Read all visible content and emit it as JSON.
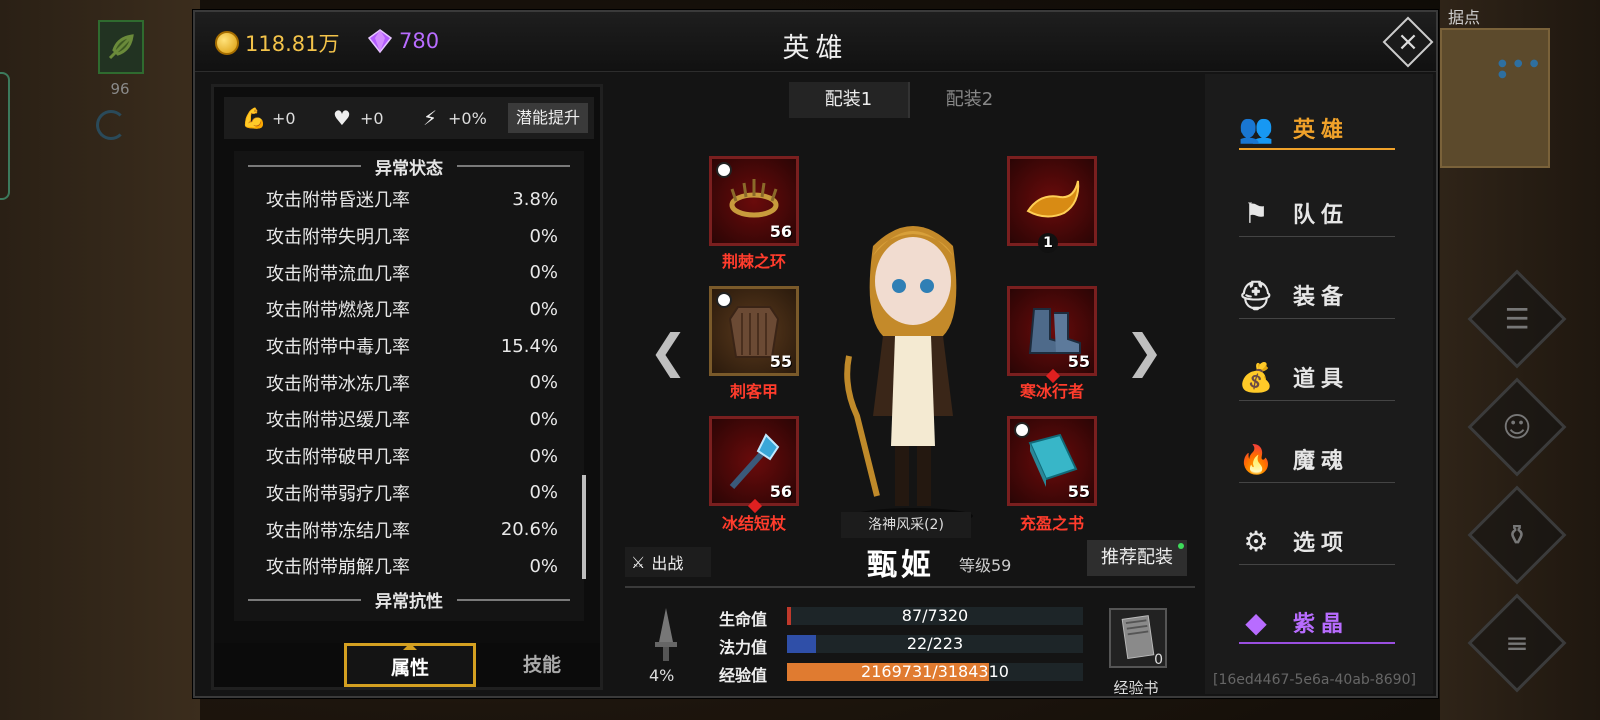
{
  "bg": {
    "mini_item_count": "96",
    "map_label": "据点"
  },
  "header": {
    "gold": "118.81万",
    "gems": "780",
    "title": "英雄"
  },
  "attr_bar": {
    "str": "+0",
    "hp": "+0",
    "spd": "+0%",
    "boost_label": "潜能提升"
  },
  "stats": {
    "section1": "异常状态",
    "rows": [
      {
        "name": "攻击附带昏迷几率",
        "value": "3.8%"
      },
      {
        "name": "攻击附带失明几率",
        "value": "0%"
      },
      {
        "name": "攻击附带流血几率",
        "value": "0%"
      },
      {
        "name": "攻击附带燃烧几率",
        "value": "0%"
      },
      {
        "name": "攻击附带中毒几率",
        "value": "15.4%"
      },
      {
        "name": "攻击附带冰冻几率",
        "value": "0%"
      },
      {
        "name": "攻击附带迟缓几率",
        "value": "0%"
      },
      {
        "name": "攻击附带破甲几率",
        "value": "0%"
      },
      {
        "name": "攻击附带弱疗几率",
        "value": "0%"
      },
      {
        "name": "攻击附带冻结几率",
        "value": "20.6%"
      },
      {
        "name": "攻击附带崩解几率",
        "value": "0%"
      }
    ],
    "section2": "异常抗性"
  },
  "left_tabs": {
    "attr": "属性",
    "skill": "技能"
  },
  "loadout": {
    "tab1": "配装1",
    "tab2": "配装2"
  },
  "equip": {
    "head": {
      "name": "荆棘之环",
      "level": "56"
    },
    "charm": {
      "count": "1"
    },
    "armor": {
      "name": "刺客甲",
      "level": "55"
    },
    "boots": {
      "name": "寒冰行者",
      "level": "55"
    },
    "weapon": {
      "name": "冰结短杖",
      "level": "56"
    },
    "book": {
      "name": "充盈之书",
      "level": "55"
    }
  },
  "hero": {
    "set": "洛神风采(2)",
    "sortie": "出战",
    "name": "甄姬",
    "level": "等级59",
    "recommend": "推荐配装"
  },
  "vitals": {
    "crit_pct": "4%",
    "hp_label": "生命值",
    "hp_text": "87/7320",
    "hp_ratio": 0.012,
    "mp_label": "法力值",
    "mp_text": "22/223",
    "mp_ratio": 0.099,
    "xp_label": "经验值",
    "xp_text": "2169731/3184310",
    "xp_ratio": 0.681,
    "book_count": "0",
    "book_label": "经验书"
  },
  "nav": [
    {
      "label": "英雄",
      "icon": "hero-icon"
    },
    {
      "label": "队伍",
      "icon": "flag-icon"
    },
    {
      "label": "装备",
      "icon": "helmet-icon"
    },
    {
      "label": "道具",
      "icon": "bag-icon"
    },
    {
      "label": "魔魂",
      "icon": "flame-icon"
    },
    {
      "label": "选项",
      "icon": "gear-icon"
    },
    {
      "label": "紫晶",
      "icon": "crystal-icon"
    }
  ],
  "uid": "[16ed4467-5e6a-40ab-8690]",
  "colors": {
    "accent": "#f0a22a",
    "purple": "#b86cff",
    "hp": "#c0392b",
    "mp": "#2f4fa8",
    "xp": "#e07b30",
    "slot_red": "#7a1f1f"
  }
}
